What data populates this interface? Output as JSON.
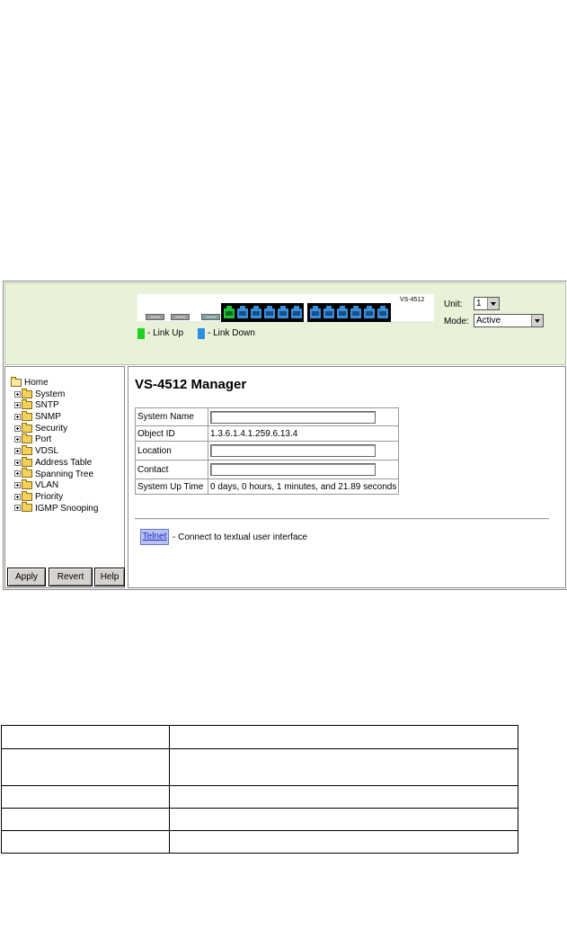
{
  "header": {
    "model_label": "VS-4512",
    "legend": [
      {
        "label": "- Link Up",
        "color": "#1fd21f"
      },
      {
        "label": "- Link Down",
        "color": "#2a8fe0"
      }
    ],
    "unit_label": "Unit:",
    "unit_value": "1",
    "mode_label": "Mode:",
    "mode_value": "Active"
  },
  "ports": {
    "sfp_ports": 3,
    "group1_ports": 6,
    "group2_ports": 6,
    "link_up_port_index": 0
  },
  "nav": {
    "home": "Home",
    "items": [
      "System",
      "SNTP",
      "SNMP",
      "Security",
      "Port",
      "VDSL",
      "Address Table",
      "Spanning Tree",
      "VLAN",
      "Priority",
      "IGMP Snooping"
    ],
    "buttons": {
      "apply": "Apply",
      "revert": "Revert",
      "help": "Help"
    }
  },
  "main": {
    "title": "VS-4512 Manager",
    "rows": [
      {
        "label": "System Name",
        "value": ""
      },
      {
        "label": "Object ID",
        "value": "1.3.6.1.4.1.259.6.13.4"
      },
      {
        "label": "Location",
        "value": ""
      },
      {
        "label": "Contact",
        "value": ""
      },
      {
        "label": "System Up Time",
        "value": "0 days, 0 hours, 1 minutes, and 21.89 seconds"
      }
    ],
    "telnet_label": "Telnet",
    "telnet_desc": "- Connect to textual user interface"
  }
}
